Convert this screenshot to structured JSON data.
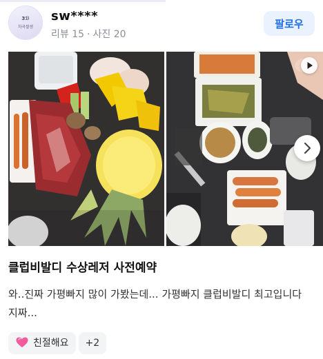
{
  "profile": {
    "avatar_text_1": "3ℬ",
    "avatar_text_2": "차곡쌓생",
    "username": "sw****",
    "reviews": "리뷰 15",
    "separator": "·",
    "photos": "사진 20",
    "follow_label": "팔로우"
  },
  "gallery": {
    "photos": [
      "bbq-platter-meat-pineapple",
      "table-side-dishes-sausages"
    ],
    "video_indicator": "play-icon",
    "next_icon": "chevron-right-icon"
  },
  "review": {
    "title": "클럽비발디 수상레저 사전예약",
    "snippet": "와..진짜 가평빠지 많이 가봤는데... 가평빠지 클럽비발디 최고입니다 지짜..."
  },
  "tags": [
    {
      "label": "친절해요",
      "icon": "heart-icon"
    },
    {
      "label": "+2"
    }
  ],
  "colors": {
    "accent": "#1f6fe5",
    "follow_bg": "#eaf2ff",
    "meta": "#8a8f99",
    "chip_bg": "#f3f4f6"
  }
}
